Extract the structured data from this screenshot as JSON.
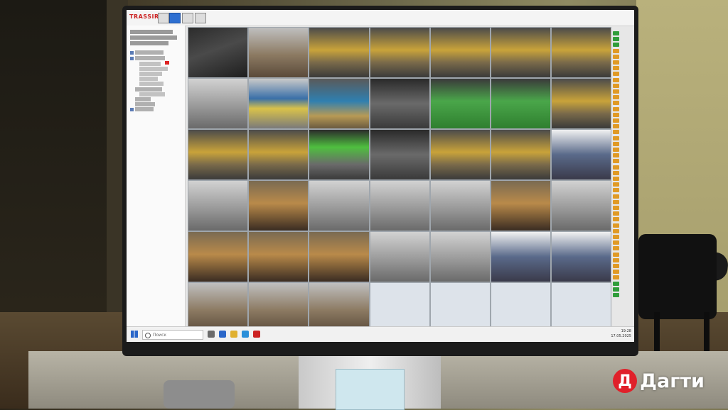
{
  "app": {
    "brand": "TRASSIR"
  },
  "taskbar": {
    "search_placeholder": "Поиск",
    "time": "19:28",
    "date": "17.05.2025"
  },
  "watermark": {
    "mark": "Д",
    "text": "Дагти"
  },
  "colors": {
    "screen_bg": "#e7e7e7",
    "accent": "#2e6fd1",
    "brand_red": "#c22222",
    "status_green": "#2f9d3a",
    "status_orange": "#e09a25",
    "logo_red": "#e0202a"
  },
  "cameras": [
    {
      "scene": "dark-room",
      "empty": false
    },
    {
      "scene": "office",
      "empty": false
    },
    {
      "scene": "gym-yellow",
      "empty": false
    },
    {
      "scene": "gym-yellow",
      "empty": false
    },
    {
      "scene": "gym-yellow",
      "empty": false
    },
    {
      "scene": "gym-yellow",
      "empty": false
    },
    {
      "scene": "gym-yellow",
      "empty": false
    },
    {
      "scene": "grey-room",
      "empty": false
    },
    {
      "scene": "gym-blue",
      "empty": false
    },
    {
      "scene": "pingpong",
      "empty": false
    },
    {
      "scene": "gym-dark",
      "empty": false
    },
    {
      "scene": "turf-green",
      "empty": false
    },
    {
      "scene": "turf-green",
      "empty": false
    },
    {
      "scene": "gym-yellow",
      "empty": false
    },
    {
      "scene": "gym-yellow",
      "empty": false
    },
    {
      "scene": "gym-yellow",
      "empty": false
    },
    {
      "scene": "gym-green",
      "empty": false
    },
    {
      "scene": "gym-dark",
      "empty": false
    },
    {
      "scene": "gym-yellow",
      "empty": false
    },
    {
      "scene": "gym-yellow",
      "empty": false
    },
    {
      "scene": "locker",
      "empty": false
    },
    {
      "scene": "grey-room",
      "empty": false
    },
    {
      "scene": "wood-room",
      "empty": false
    },
    {
      "scene": "grey-room",
      "empty": false
    },
    {
      "scene": "grey-room",
      "empty": false
    },
    {
      "scene": "grey-room",
      "empty": false
    },
    {
      "scene": "wood-room",
      "empty": false
    },
    {
      "scene": "grey-room",
      "empty": false
    },
    {
      "scene": "wood-room",
      "empty": false
    },
    {
      "scene": "wood-room",
      "empty": false
    },
    {
      "scene": "wood-room",
      "empty": false
    },
    {
      "scene": "grey-room",
      "empty": false
    },
    {
      "scene": "grey-room",
      "empty": false
    },
    {
      "scene": "locker",
      "empty": false
    },
    {
      "scene": "locker",
      "empty": false
    },
    {
      "scene": "office",
      "empty": false
    },
    {
      "scene": "office",
      "empty": false
    },
    {
      "scene": "office",
      "empty": false
    },
    {
      "scene": "none",
      "empty": true
    },
    {
      "scene": "none",
      "empty": true
    },
    {
      "scene": "none",
      "empty": true
    },
    {
      "scene": "none",
      "empty": true
    }
  ]
}
